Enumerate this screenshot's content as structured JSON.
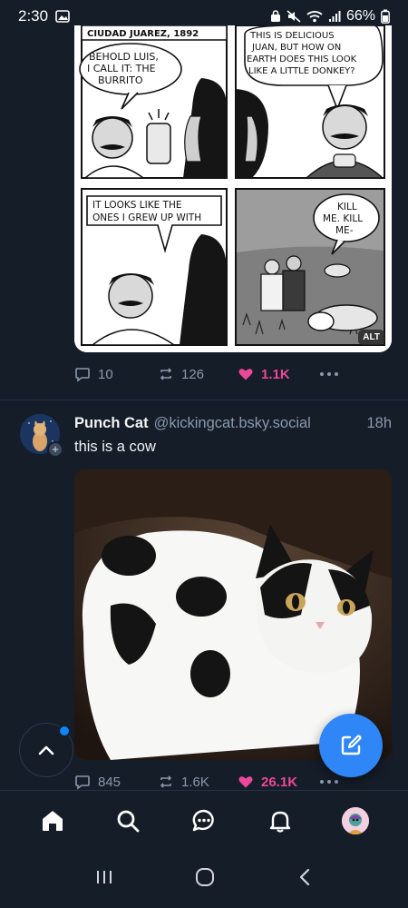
{
  "status_bar": {
    "time": "2:30",
    "battery": "66%"
  },
  "comic": {
    "panels": {
      "p1_caption": "CIUDAD JUAREZ, 1892",
      "p1_bubble": [
        "BEHOLD LUIS,",
        "I CALL IT: THE",
        "BURRITO"
      ],
      "p2_bubble": [
        "THIS IS DELICIOUS",
        "JUAN, BUT HOW ON",
        "EARTH DOES THIS LOOK",
        "LIKE A LITTLE DONKEY?"
      ],
      "p3_bubble": [
        "IT LOOKS LIKE THE",
        "ONES I GREW UP WITH"
      ],
      "p4_bubble": [
        "KILL",
        "ME. KILL",
        "ME-"
      ]
    },
    "alt_label": "ALT"
  },
  "post1_actions": {
    "replies": "10",
    "reposts": "126",
    "likes": "1.1K"
  },
  "post2": {
    "display_name": "Punch Cat",
    "handle": "@kickingcat.bsky.social",
    "timestamp": "18h",
    "text": "this is a cow",
    "replies": "845",
    "reposts": "1.6K",
    "likes": "26.1K"
  },
  "colors": {
    "background": "#151d28",
    "accent": "#2f86f6",
    "like": "#ec4899",
    "muted": "#8b99ac"
  },
  "icons": {
    "nav": [
      "home-icon",
      "search-icon",
      "chat-icon",
      "bell-icon",
      "profile-avatar"
    ],
    "android": [
      "recents-icon",
      "home-circle-icon",
      "back-icon"
    ]
  }
}
